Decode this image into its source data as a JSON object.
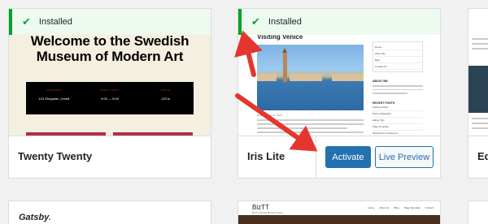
{
  "themes": [
    {
      "name": "Twenty Twenty",
      "installed_label": "Installed",
      "preview": {
        "heading_line1": "Welcome to the Swedish",
        "heading_line2": "Museum of Modern Art",
        "info": [
          {
            "label": "ADDRESS",
            "value": "123 Storgatan, Umeå"
          },
          {
            "label": "OPEN TODAY",
            "value": "9:00 — 5:00"
          },
          {
            "label": "PRICE",
            "value": "129 kr"
          }
        ]
      }
    },
    {
      "name": "Iris Lite",
      "installed_label": "Installed",
      "activate_label": "Activate",
      "live_preview_label": "Live Preview",
      "preview": {
        "post_title": "Visiting Venice",
        "post_meta": "Roger   January 9, 2019",
        "menu": [
          "Home",
          "About Me",
          "Blog",
          "Contact Us"
        ],
        "about_heading": "ABOUT ME",
        "recent_heading": "RECENT POSTS",
        "recent_posts": [
          "Visiting Venice",
          "Paris Is Beautiful",
          "Hiking Tips",
          "Page Template",
          "Wordpress Is Awesome"
        ]
      }
    },
    {
      "name": "Ed"
    },
    {
      "name": "Gatsby",
      "dot": "."
    },
    {
      "name": "BizTT",
      "tagline": "BizTT Corporate Business Theme",
      "nav": [
        "Home",
        "About Us",
        "Blog",
        "Page Template",
        "Contact"
      ]
    }
  ],
  "colors": {
    "installed_bg": "#edfaef",
    "installed_accent": "#00a32a",
    "primary_button": "#2271b1",
    "arrow": "#e4362e"
  }
}
